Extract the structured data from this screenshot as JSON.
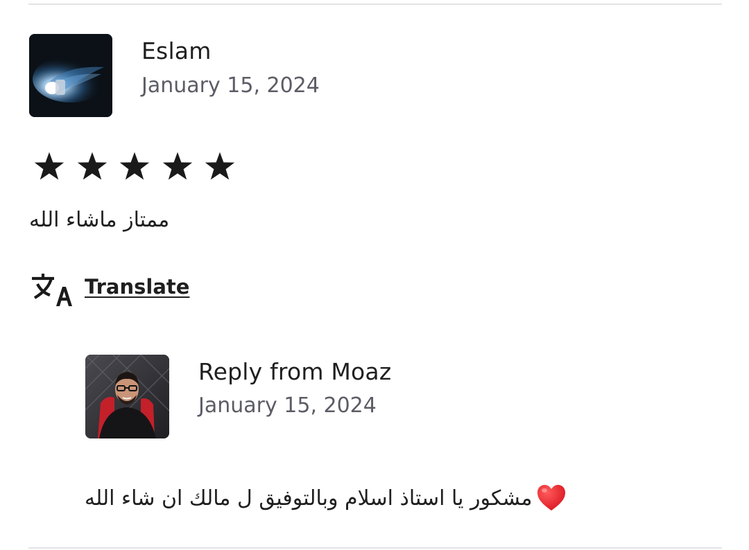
{
  "review": {
    "reviewer_name": "Eslam",
    "date": "January 15, 2024",
    "rating": 5,
    "rating_max": 5,
    "text": "ممتاز ماشاء الله",
    "translate_label": "Translate"
  },
  "reply": {
    "title": "Reply from Moaz",
    "date": "January 15, 2024",
    "text": "مشكور يا استاذ اسلام وبالتوفيق ل مالك ان شاء الله",
    "emoji": "heart-icon"
  },
  "icons": {
    "star": "star-icon",
    "translate": "translate-icon"
  },
  "colors": {
    "text_primary": "#1f1f1f",
    "text_secondary": "#5c5c66",
    "star": "#1a1a1a",
    "heart": "#e8202a",
    "divider": "#e3e3e6"
  }
}
